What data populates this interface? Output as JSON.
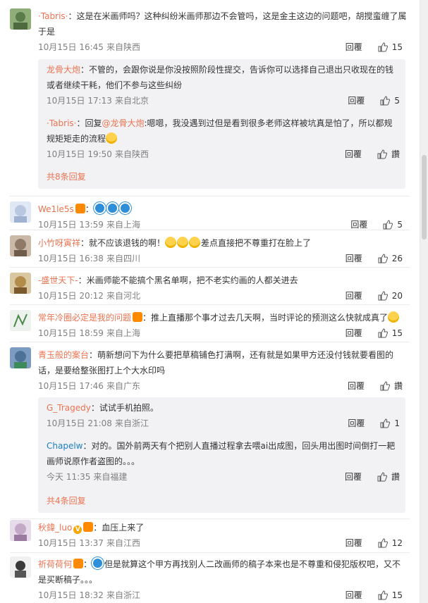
{
  "ui": {
    "reply_label": "回覆",
    "like_icon": "thumbs-up-icon",
    "accent": "#eb7350"
  },
  "comments": [
    {
      "user": "·Tabris·",
      "text": "：这是在米画师吗？这种纠纷米画师那边不会管吗，这是金主这边的问题吧，胡搅蛮缠了属于是",
      "date": "10月15日 16:45",
      "place": "来自陕西",
      "likes": "15",
      "replies": [
        {
          "user": "龙骨大炮",
          "text": "：不管的，会跟你说是你没按照阶段性提交，告诉你可以选择自己退出只收现在的钱或者继续干耗，他们不参与这些纠纷",
          "date": "10月15日 17:13",
          "place": "来自北京",
          "likes": "5"
        },
        {
          "user": "·Tabris·",
          "pre": "：回复",
          "mention": "@龙骨大炮",
          "text": ":嗯嗯，我没遇到过但是看到很多老师这样被坑真是怕了，所以都规规矩矩走的流程",
          "date": "10月15日 19:50",
          "place": "来自陕西",
          "likes": "讚"
        }
      ],
      "more": "共8条回复"
    },
    {
      "user": "We1le5s",
      "text": "",
      "date": "10月15日 13:59",
      "place": "来自上海",
      "likes": "5"
    },
    {
      "user": "小竹呀寅祥",
      "text": "：就不应该退钱的啊！",
      "text2": "差点直接把不尊重打在脸上了",
      "date": "10月15日 16:38",
      "place": "来自四川",
      "likes": "26"
    },
    {
      "user": "-盛世天下-",
      "text": "：米画师能不能搞个黑名单啊，把不老实约画的人都关进去",
      "date": "10月15日 20:12",
      "place": "来自河北",
      "likes": "20"
    },
    {
      "user": "常年冷圈必定是我的问题",
      "text": "：推上直播那个事才过去几天啊，当时评论的预测这么快就成真了",
      "date": "10月15日 18:59",
      "place": "来自上海",
      "likes": "15"
    },
    {
      "user": "青玉般的案台",
      "text": "：萌新想问下为什么要把草稿铺色打满啊，还有就是如果甲方还没付钱就要看图的话，是要给整张图打上个大水印吗",
      "date": "10月15日 17:46",
      "place": "来自广东",
      "likes": "讚",
      "replies": [
        {
          "user": "G_Tragedy",
          "text": "：试试手机拍照。",
          "date": "10月15日 21:08",
          "place": "来自浙江",
          "likes": "1"
        },
        {
          "user": "Chapelw",
          "text": "：对的。国外前两天有个把别人直播过程拿去喂ai出成图，回头用出图时间倒打一耙画师说原作者盗图的。。。",
          "date": "今天 11:35",
          "place": "来自福建",
          "likes": "讚"
        }
      ],
      "more": "共4条回复"
    },
    {
      "user": "秋鍏_luo",
      "text": "：血压上来了",
      "date": "10月15日 13:37",
      "place": "来自江西",
      "likes": "12"
    },
    {
      "user": "祈荷荷何",
      "text": "但是就算这个甲方再找别人二改画师的稿子本来也是不尊重和侵犯版权吧，又不是买断稿子。。。",
      "date": "10月15日 18:32",
      "place": "来自浙江",
      "likes": "15"
    }
  ]
}
